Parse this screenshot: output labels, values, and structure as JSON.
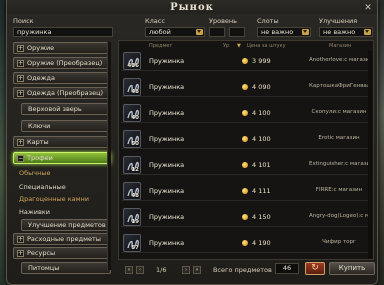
{
  "window": {
    "title": "Рынок"
  },
  "filters": {
    "search_label": "Поиск",
    "search_value": "пружинка",
    "class_label": "Класс",
    "class_value": "любой",
    "level_label": "Уровень",
    "slots_label": "Слоты",
    "slots_value": "не важно",
    "upgrade_label": "Улучшения",
    "upgrade_value": "не важно"
  },
  "categories": [
    {
      "label": "Оружие",
      "sign": "+"
    },
    {
      "label": "Оружие (Преобразец)",
      "sign": "+"
    },
    {
      "label": "Одежда",
      "sign": "+"
    },
    {
      "label": "Одежда (Преобразец)",
      "sign": "+"
    },
    {
      "label": "Верховой зверь",
      "sign": ""
    },
    {
      "label": "Ключи",
      "sign": ""
    },
    {
      "label": "Карты",
      "sign": "+"
    },
    {
      "label": "Трофеи",
      "sign": "−"
    }
  ],
  "subcategories": [
    "Обычные",
    "Специальные",
    "Драгоценные камни",
    "Наживки"
  ],
  "categories_bottom": [
    {
      "label": "Улучшение предметов",
      "sign": ""
    },
    {
      "label": "Расходные предметы",
      "sign": "+"
    },
    {
      "label": "Ресурсы",
      "sign": "+"
    },
    {
      "label": "Питомцы",
      "sign": ""
    }
  ],
  "table": {
    "headers": {
      "item": "Предмет",
      "level": "Ур",
      "price": "Цена за штуку",
      "seller": "Магазин"
    },
    "rows": [
      {
        "qty": "436",
        "name": "Пружинка",
        "price": "3 999",
        "seller": "Anotherlove:с магазин"
      },
      {
        "qty": "48",
        "name": "Пружинка",
        "price": "4 090",
        "seller": "КартошкаФриГенвал:с магазин"
      },
      {
        "qty": "40",
        "name": "Пружинка",
        "price": "4 100",
        "seller": "Скопули:с магазин"
      },
      {
        "qty": "50",
        "name": "Пружинка",
        "price": "4 100",
        "seller": "Erotic магазин"
      },
      {
        "qty": "12",
        "name": "Пружинка",
        "price": "4 101",
        "seller": "Extinguisher:с магазин"
      },
      {
        "qty": "48",
        "name": "Пружинка",
        "price": "4 111",
        "seller": "FIRRE:с магазин"
      },
      {
        "qty": "19",
        "name": "Пружинка",
        "price": "4 150",
        "seller": "Angry-dog(Logeo):с магазин"
      },
      {
        "qty": "57",
        "name": "Пружинка",
        "price": "4 190",
        "seller": "Чифир торг"
      }
    ]
  },
  "footer": {
    "page": "1/6",
    "total_label": "Всего предметов",
    "total_value": "46",
    "buy_label": "Купить"
  },
  "colors": {
    "accent_green": "#8fc13a",
    "gold": "#c98e12"
  }
}
